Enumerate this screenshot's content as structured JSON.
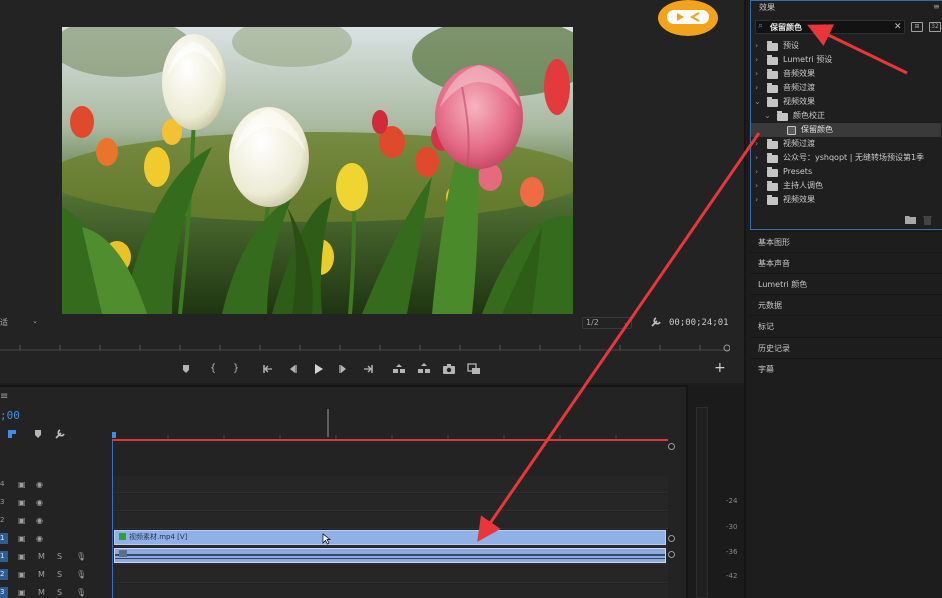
{
  "monitor": {
    "fit_value": "适",
    "resolution_value": "1/2",
    "timecode": "00;00;24;01"
  },
  "timeline": {
    "timecode": ";00",
    "tracks": [
      {
        "id": "4",
        "type": "video"
      },
      {
        "id": "3",
        "type": "video"
      },
      {
        "id": "2",
        "type": "video"
      },
      {
        "id": "1",
        "type": "video",
        "active": true
      },
      {
        "id": "1",
        "type": "audio",
        "active": true,
        "m": "M",
        "s": "S"
      },
      {
        "id": "2",
        "type": "audio",
        "active": true,
        "m": "M",
        "s": "S"
      },
      {
        "id": "3",
        "type": "audio",
        "active": true,
        "m": "M",
        "s": "S"
      }
    ],
    "video_clip_label": "视频素材.mp4 [V]"
  },
  "meters": {
    "ticks": [
      "-24",
      "-30",
      "-36",
      "-42"
    ]
  },
  "effects": {
    "title": "效果",
    "search_value": "保留颜色",
    "tree": [
      {
        "label": "预设",
        "level": 0,
        "expanded": false
      },
      {
        "label": "Lumetri 预设",
        "level": 0,
        "expanded": false
      },
      {
        "label": "音频效果",
        "level": 0,
        "expanded": false
      },
      {
        "label": "音频过渡",
        "level": 0,
        "expanded": false
      },
      {
        "label": "视频效果",
        "level": 0,
        "expanded": true
      },
      {
        "label": "颜色校正",
        "level": 1,
        "expanded": true
      },
      {
        "label": "保留颜色",
        "level": 2,
        "file": true,
        "selected": true
      },
      {
        "label": "视频过渡",
        "level": 0,
        "expanded": false
      },
      {
        "label": "公众号：yshqopt | 无缝转场预设第1季",
        "level": 0,
        "expanded": false
      },
      {
        "label": "Presets",
        "level": 0,
        "expanded": false
      },
      {
        "label": "主持人调色",
        "level": 0,
        "expanded": false
      },
      {
        "label": "视频效果",
        "level": 0,
        "expanded": false
      }
    ]
  },
  "panels": {
    "essential_graphics": "基本图形",
    "essential_sound": "基本声音",
    "lumetri_color": "Lumetri 颜色",
    "metadata": "元数据",
    "markers": "标记",
    "history": "历史记录",
    "captions": "字幕"
  },
  "colors": {
    "accent_blue": "#3c8fe6",
    "annotation_red": "#e8363a",
    "clip_blue": "#90b0e8"
  }
}
